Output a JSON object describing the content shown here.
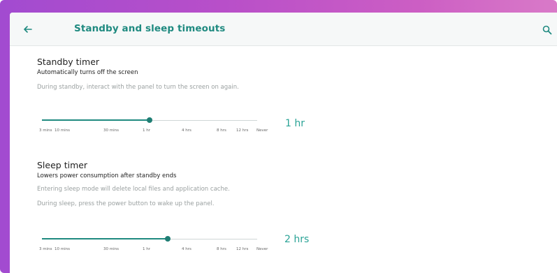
{
  "header": {
    "title": "Standby and sleep timeouts",
    "back_icon": "arrow-left-icon",
    "search_icon": "search-icon"
  },
  "colors": {
    "accent": "#1f8a80",
    "value_text": "#2aa396",
    "frame_gradient_start": "#a24bd0",
    "frame_gradient_end": "#d97ac8"
  },
  "standby": {
    "title": "Standby timer",
    "subtitle": "Automatically turns off the screen",
    "description": "During standby, interact with the panel to turn the screen on again.",
    "value": "1 hr",
    "position": 0.5
  },
  "sleep": {
    "title": "Sleep timer",
    "subtitle": "Lowers power consumption after standby ends",
    "description_1": "Entering sleep mode will delete local files and application cache.",
    "description_2": "During sleep, press the power button to wake up the panel.",
    "value": "2 hrs",
    "position": 0.583
  },
  "ticks": [
    "3 mins",
    "10 mins",
    "30 mins",
    "1 hr",
    "4 hrs",
    "8 hrs",
    "12 hrs",
    "Never"
  ]
}
